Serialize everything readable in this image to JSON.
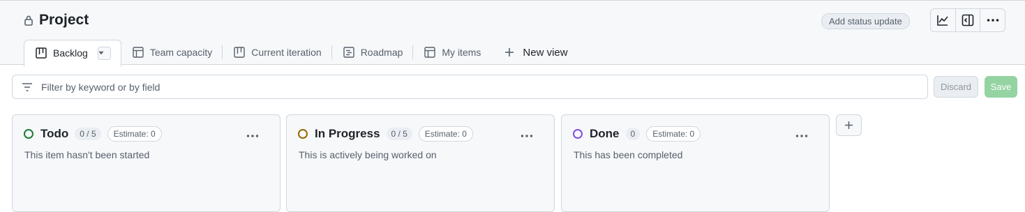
{
  "header": {
    "project_title": "Project",
    "status_update_label": "Add status update",
    "icons": [
      "insights-icon",
      "side-panel-icon",
      "more-icon"
    ]
  },
  "tabs": [
    {
      "label": "Backlog",
      "icon": "board-icon",
      "active": true
    },
    {
      "label": "Team capacity",
      "icon": "table-icon",
      "active": false
    },
    {
      "label": "Current iteration",
      "icon": "board-icon",
      "active": false
    },
    {
      "label": "Roadmap",
      "icon": "roadmap-icon",
      "active": false
    },
    {
      "label": "My items",
      "icon": "table-icon",
      "active": false
    }
  ],
  "new_view_label": "New view",
  "filter": {
    "placeholder": "Filter by keyword or by field",
    "discard_label": "Discard",
    "save_label": "Save"
  },
  "columns": [
    {
      "name": "Todo",
      "count": "0 / 5",
      "estimate": "Estimate: 0",
      "description": "This item hasn't been started",
      "color": "#1a7f37"
    },
    {
      "name": "In Progress",
      "count": "0 / 5",
      "estimate": "Estimate: 0",
      "description": "This is actively being worked on",
      "color": "#9a6700"
    },
    {
      "name": "Done",
      "count": "0",
      "estimate": "Estimate: 0",
      "description": "This has been completed",
      "color": "#8250df"
    }
  ],
  "colors": {
    "accent_green": "#94d3a2",
    "border": "#d0d7de",
    "muted_text": "#57606a"
  }
}
